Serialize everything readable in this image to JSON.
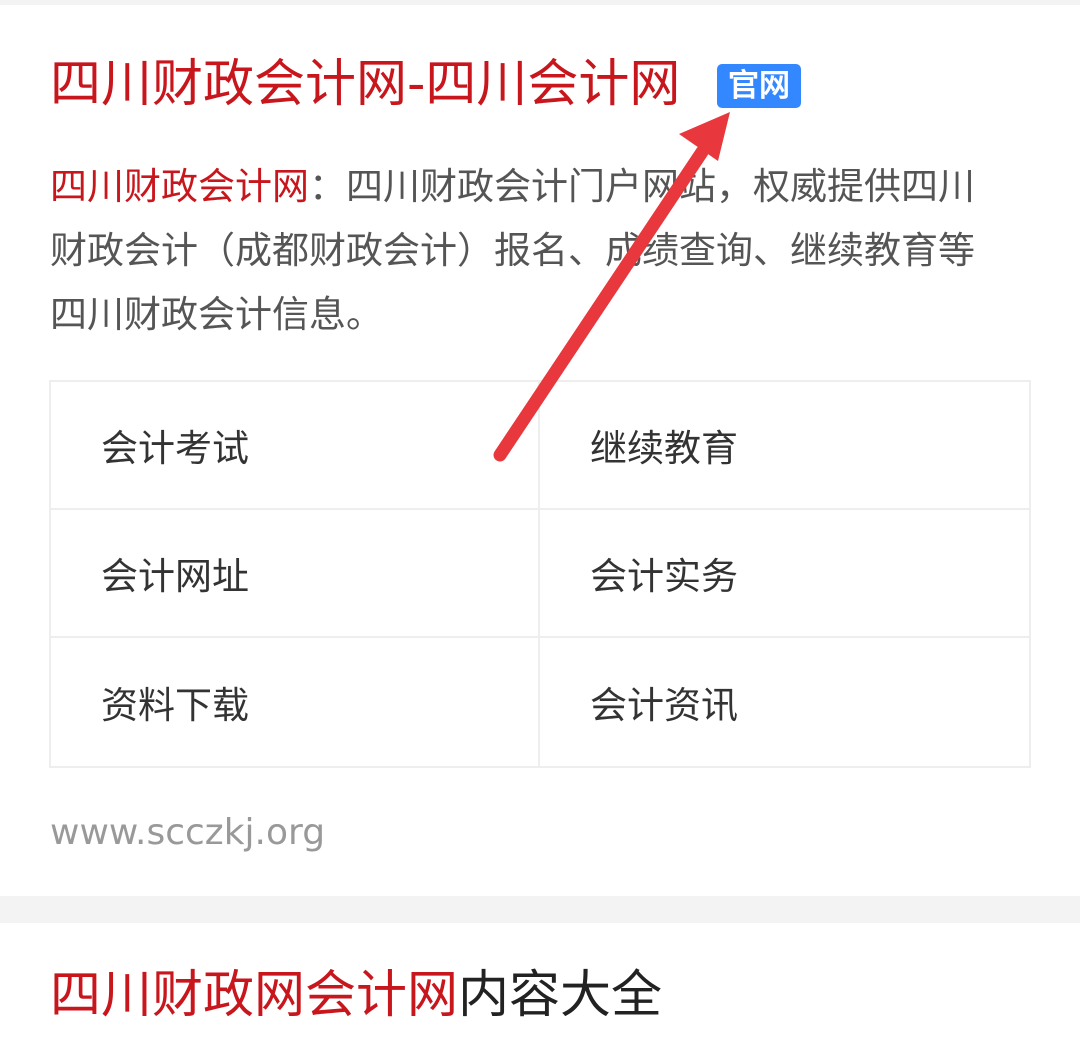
{
  "result": {
    "title": "四川财政会计网-四川会计网",
    "badge": "官网",
    "snippet_highlight": "四川财政会计网",
    "snippet_text": "：四川财政会计门户网站，权威提供四川财政会计（成都财政会计）报名、成绩查询、继续教育等四川财政会计信息。",
    "url": "www.scczkj.org"
  },
  "sitelinks": [
    {
      "label": "会计考试"
    },
    {
      "label": "继续教育"
    },
    {
      "label": "会计网址"
    },
    {
      "label": "会计实务"
    },
    {
      "label": "资料下载"
    },
    {
      "label": "会计资讯"
    }
  ],
  "section": {
    "title_highlight": "四川财政网会计网",
    "title_rest": "内容大全"
  },
  "colors": {
    "title_red": "#c8161d",
    "badge_blue": "#3388ff",
    "arrow_red": "#e8383d"
  }
}
